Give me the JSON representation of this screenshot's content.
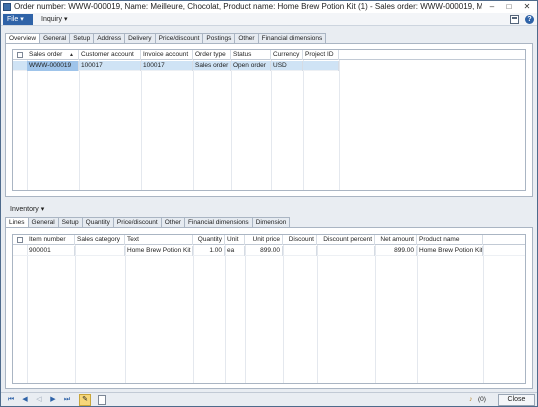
{
  "window": {
    "title": "Order number: WWW-000019, Name: Meilleure, Chocolat, Product name: Home Brew Potion Kit (1) - Sales order: WWW-000019, Meille...",
    "min": "–",
    "max": "□",
    "close": "✕"
  },
  "menubar": {
    "file": "File ▾",
    "inquiry": "Inquiry ▾",
    "help": "?"
  },
  "header_tabs": [
    "Overview",
    "General",
    "Setup",
    "Address",
    "Delivery",
    "Price/discount",
    "Postings",
    "Other",
    "Financial dimensions"
  ],
  "orders": {
    "columns": [
      "Sales order",
      "Customer account",
      "Invoice account",
      "Order type",
      "Status",
      "Currency",
      "Project ID"
    ],
    "rows": [
      [
        "WWW-000019",
        "100017",
        "100017",
        "Sales order",
        "Open order",
        "USD",
        ""
      ]
    ]
  },
  "inventory": {
    "label": "Inventory ▾"
  },
  "line_tabs": [
    "Lines",
    "General",
    "Setup",
    "Quantity",
    "Price/discount",
    "Other",
    "Financial dimensions",
    "Dimension"
  ],
  "lines": {
    "columns": [
      "Item number",
      "Sales category",
      "Text",
      "Quantity",
      "Unit",
      "Unit price",
      "Discount",
      "Discount percent",
      "Net amount",
      "Product name"
    ],
    "rows": [
      [
        "900001",
        "",
        "Home Brew Potion Kit",
        "1.00",
        "ea",
        "899.00",
        "",
        "",
        "899.00",
        "Home Brew Potion Kit"
      ]
    ]
  },
  "status": {
    "nav_first": "⏮",
    "nav_prev": "◀",
    "nav_prev_disabled": "◁",
    "nav_next": "▶",
    "nav_last": "⏭",
    "edit": "✎",
    "bell": "♪",
    "notifications": "(0)",
    "close_label": "Close"
  },
  "colors": {
    "accent": "#2f63a8",
    "selected_row": "#cfe3f5",
    "focus_cell": "#9fc4ea"
  }
}
